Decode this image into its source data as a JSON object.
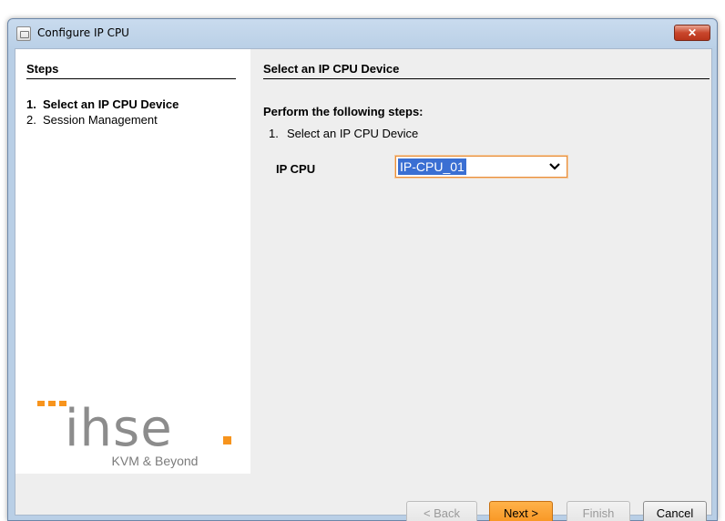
{
  "window": {
    "title": "Configure IP CPU",
    "close_label": "✕"
  },
  "steps": {
    "header": "Steps",
    "items": [
      {
        "num": "1.",
        "label": "Select an IP CPU Device",
        "active": true
      },
      {
        "num": "2.",
        "label": "Session Management",
        "active": false
      }
    ]
  },
  "logo": {
    "brand": "ihse.",
    "tagline": "KVM & Beyond",
    "colors": {
      "grey": "#8c8c8c",
      "orange": "#f7941d"
    }
  },
  "main": {
    "header": "Select an IP CPU Device",
    "instruction": "Perform the following steps:",
    "substeps": [
      {
        "num": "1.",
        "label": "Select an IP CPU Device"
      }
    ],
    "ip_cpu": {
      "label": "IP CPU",
      "selected": "IP-CPU_01"
    }
  },
  "buttons": {
    "back": "< Back",
    "next": "Next >",
    "finish": "Finish",
    "cancel": "Cancel"
  }
}
